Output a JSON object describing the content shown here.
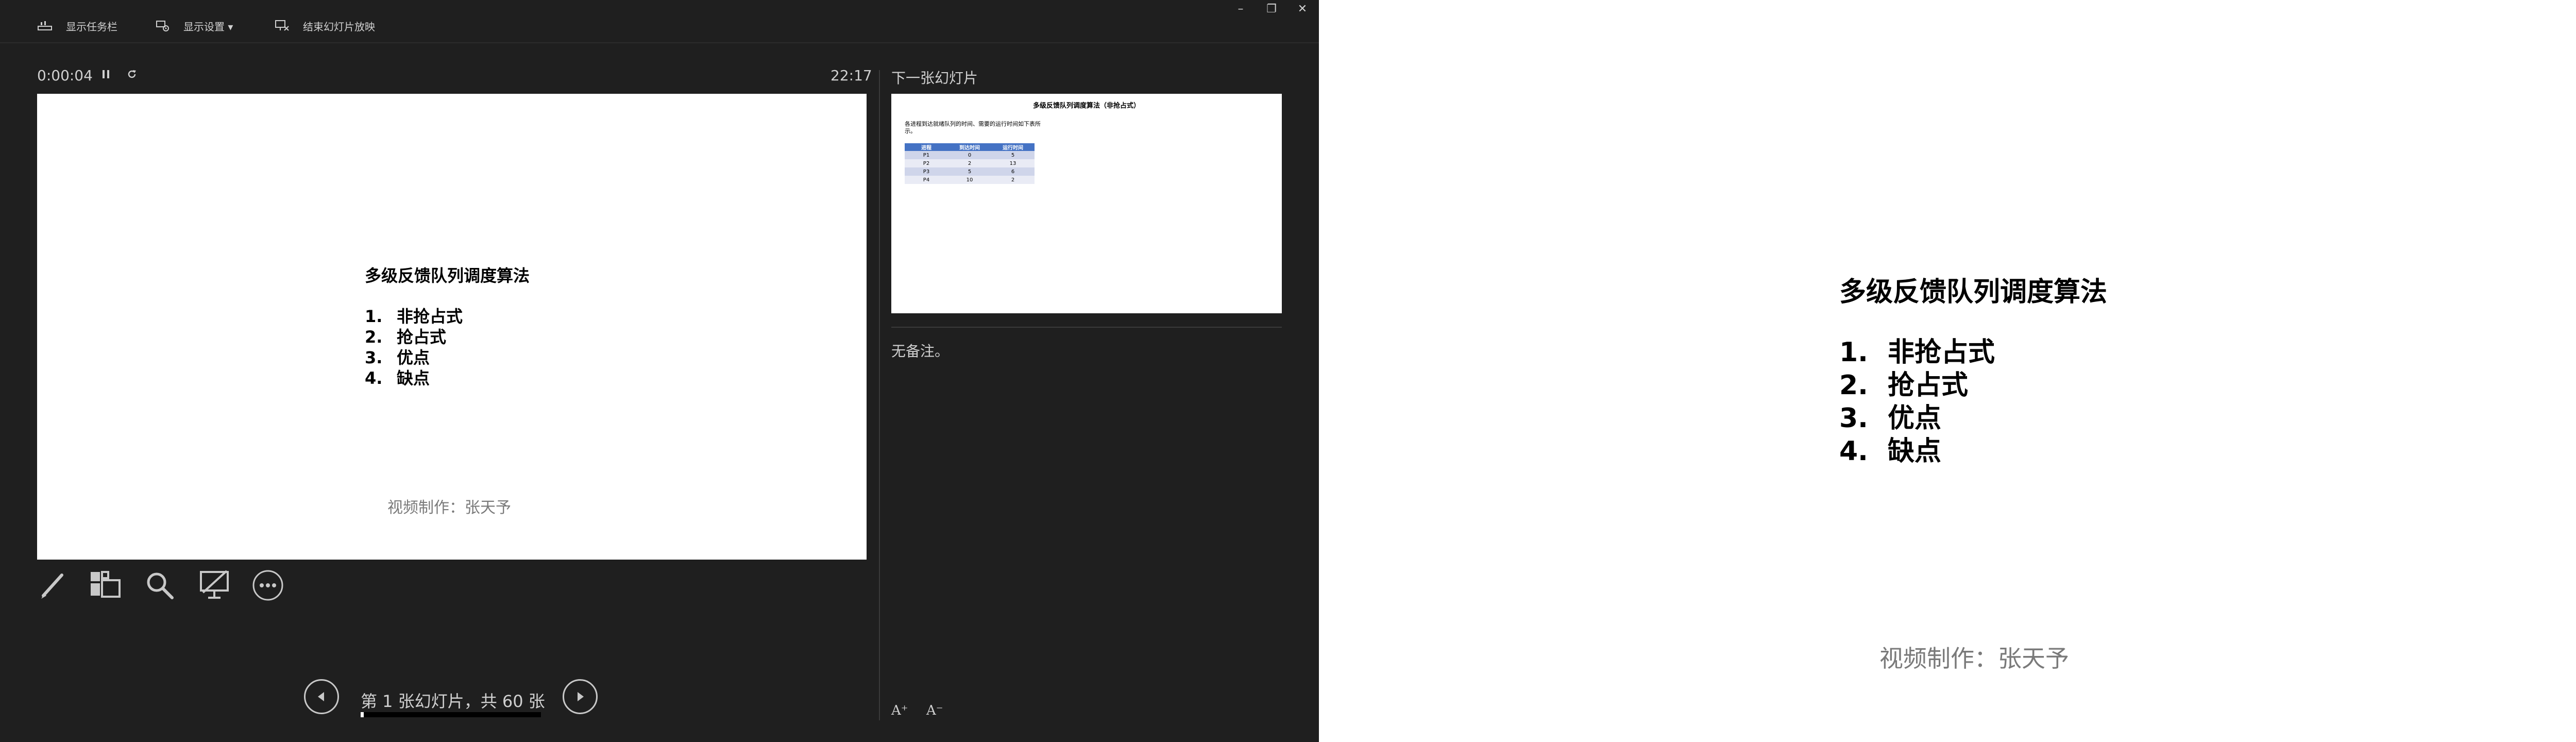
{
  "topbar": {
    "show_taskbar": "显示任务栏",
    "display_settings": "显示设置 ▾",
    "end_slideshow": "结束幻灯片放映"
  },
  "window_controls": {
    "minimize": "–",
    "restore": "❐",
    "close": "✕"
  },
  "timer": {
    "elapsed": "0:00:04",
    "clock": "22:17"
  },
  "current_slide": {
    "title": "多级反馈队列调度算法",
    "items": [
      {
        "num": "1.",
        "text": "非抢占式"
      },
      {
        "num": "2.",
        "text": "抢占式"
      },
      {
        "num": "3.",
        "text": "优点"
      },
      {
        "num": "4.",
        "text": "缺点"
      }
    ],
    "credit": "视频制作：张天予"
  },
  "tools": [
    "pen-tool",
    "all-slides",
    "zoom",
    "black-screen",
    "more-options"
  ],
  "next_slide": {
    "label": "下一张幻灯片",
    "title": "多级反馈队列调度算法（非抢占式）",
    "text": "各进程到达就绪队列的时间、需要的运行时间如下表所示。",
    "table": {
      "headers": [
        "进程",
        "到达时间",
        "运行时间"
      ],
      "rows": [
        [
          "P1",
          "0",
          "5"
        ],
        [
          "P2",
          "2",
          "13"
        ],
        [
          "P3",
          "5",
          "6"
        ],
        [
          "P4",
          "10",
          "2"
        ]
      ]
    }
  },
  "notes": {
    "text": "无备注。"
  },
  "font_controls": {
    "increase": "A⁺",
    "decrease": "A⁻"
  },
  "navigation": {
    "counter": "第 1 张幻灯片，共 60 张",
    "progress": 0.0167
  },
  "audience": {
    "title": "多级反馈队列调度算法",
    "items": [
      {
        "num": "1.",
        "text": "非抢占式"
      },
      {
        "num": "2.",
        "text": "抢占式"
      },
      {
        "num": "3.",
        "text": "优点"
      },
      {
        "num": "4.",
        "text": "缺点"
      }
    ],
    "credit": "视频制作：张天予"
  },
  "colors": {
    "presenter_bg": "#1f1f1f",
    "table_header": "#4472c4",
    "table_row_odd": "#cfd5ea",
    "table_row_even": "#e9ebf5"
  }
}
